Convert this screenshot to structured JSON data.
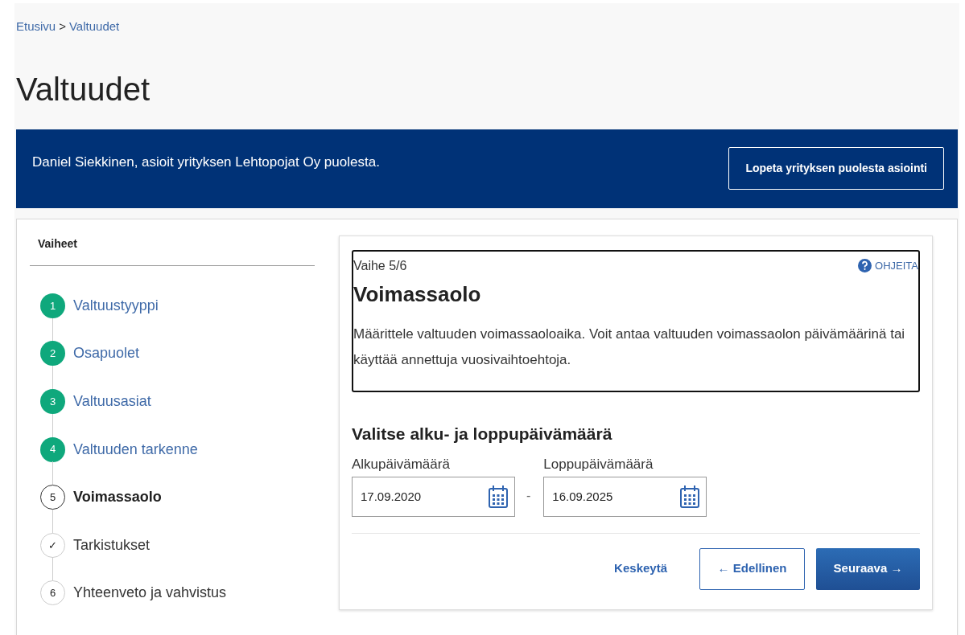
{
  "breadcrumb": {
    "items": [
      {
        "label": "Etusivu"
      },
      {
        "label": "Valtuudet"
      }
    ],
    "separator": ">"
  },
  "title": "Valtuudet",
  "banner": {
    "text": "Daniel Siekkinen, asioit yrityksen Lehtopojat Oy puolesta.",
    "button": "Lopeta yrityksen puolesta asiointi"
  },
  "steps": {
    "heading": "Vaiheet",
    "items": [
      {
        "badge": "1",
        "label": "Valtuustyyppi",
        "kind": "done"
      },
      {
        "badge": "2",
        "label": "Osapuolet",
        "kind": "done"
      },
      {
        "badge": "3",
        "label": "Valtuusasiat",
        "kind": "done"
      },
      {
        "badge": "4",
        "label": "Valtuuden tarkenne",
        "kind": "done"
      },
      {
        "badge": "5",
        "label": "Voimassaolo",
        "kind": "current"
      },
      {
        "badge": "✓",
        "label": "Tarkistukset",
        "kind": "todo"
      },
      {
        "badge": "6",
        "label": "Yhteenveto ja vahvistus",
        "kind": "todo"
      }
    ]
  },
  "intro": {
    "step": "Vaihe 5/6",
    "help": "OHJEITA",
    "heading": "Voimassaolo",
    "text": "Määrittele valtuuden voimassaoloaika. Voit antaa valtuuden voimassaolon päivämäärinä tai käyttää annettuja vuosivaihtoehtoja."
  },
  "dates": {
    "heading": "Valitse alku- ja loppupäivämäärä",
    "separator": "-",
    "fields": [
      {
        "label": "Alkupäivämäärä",
        "value": "17.09.2020"
      },
      {
        "label": "Loppupäivämäärä",
        "value": "16.09.2025"
      }
    ]
  },
  "actions": {
    "cancel": "Keskeytä",
    "previous": "← Edellinen",
    "next": "Seuraava →"
  }
}
